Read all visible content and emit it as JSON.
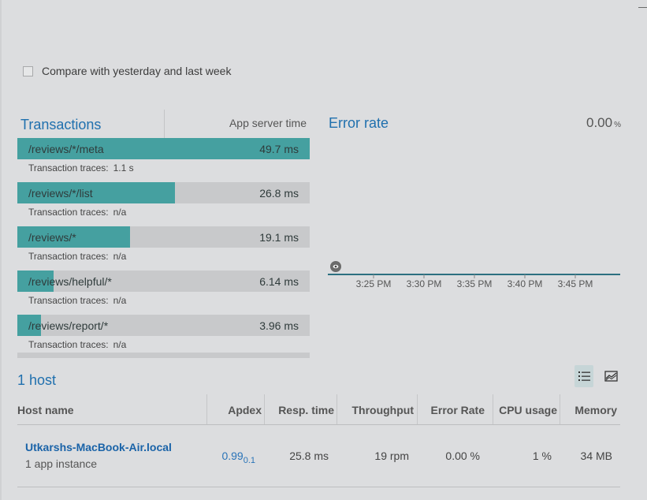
{
  "compare": {
    "label": "Compare with yesterday and last week",
    "checked": false
  },
  "transactions": {
    "title": "Transactions",
    "column_label": "App server time",
    "traces_label": "Transaction traces:",
    "max_value_ms": 49.7,
    "items": [
      {
        "name": "/reviews/*/meta",
        "value": "49.7 ms",
        "value_ms": 49.7,
        "traces": "1.1 s"
      },
      {
        "name": "/reviews/*/list",
        "value": "26.8 ms",
        "value_ms": 26.8,
        "traces": "n/a"
      },
      {
        "name": "/reviews/*",
        "value": "19.1 ms",
        "value_ms": 19.1,
        "traces": "n/a"
      },
      {
        "name": "/reviews/helpful/*",
        "value": "6.14 ms",
        "value_ms": 6.14,
        "traces": "n/a"
      },
      {
        "name": "/reviews/report/*",
        "value": "3.96 ms",
        "value_ms": 3.96,
        "traces": "n/a"
      }
    ],
    "bar_color": "#45a0a0"
  },
  "error_rate": {
    "title": "Error rate",
    "value": "0.00",
    "unit": "%",
    "x_ticks": [
      "3:25 PM",
      "3:30 PM",
      "3:35 PM",
      "3:40 PM",
      "3:45 PM"
    ],
    "line_color": "#2c6f80"
  },
  "hosts": {
    "count_label": "1 host",
    "columns": [
      "Host name",
      "Apdex",
      "Resp. time",
      "Throughput",
      "Error Rate",
      "CPU usage",
      "Memory"
    ],
    "rows": [
      {
        "name": "Utkarshs-MacBook-Air.local",
        "sub": "1 app instance",
        "apdex": "0.99",
        "apdex_t": "0.1",
        "resp_time": "25.8 ms",
        "throughput": "19 rpm",
        "error_rate": "0.00 %",
        "cpu": "1 %",
        "memory": "34 MB"
      }
    ],
    "views": [
      "list-view-icon",
      "chart-view-icon"
    ]
  }
}
